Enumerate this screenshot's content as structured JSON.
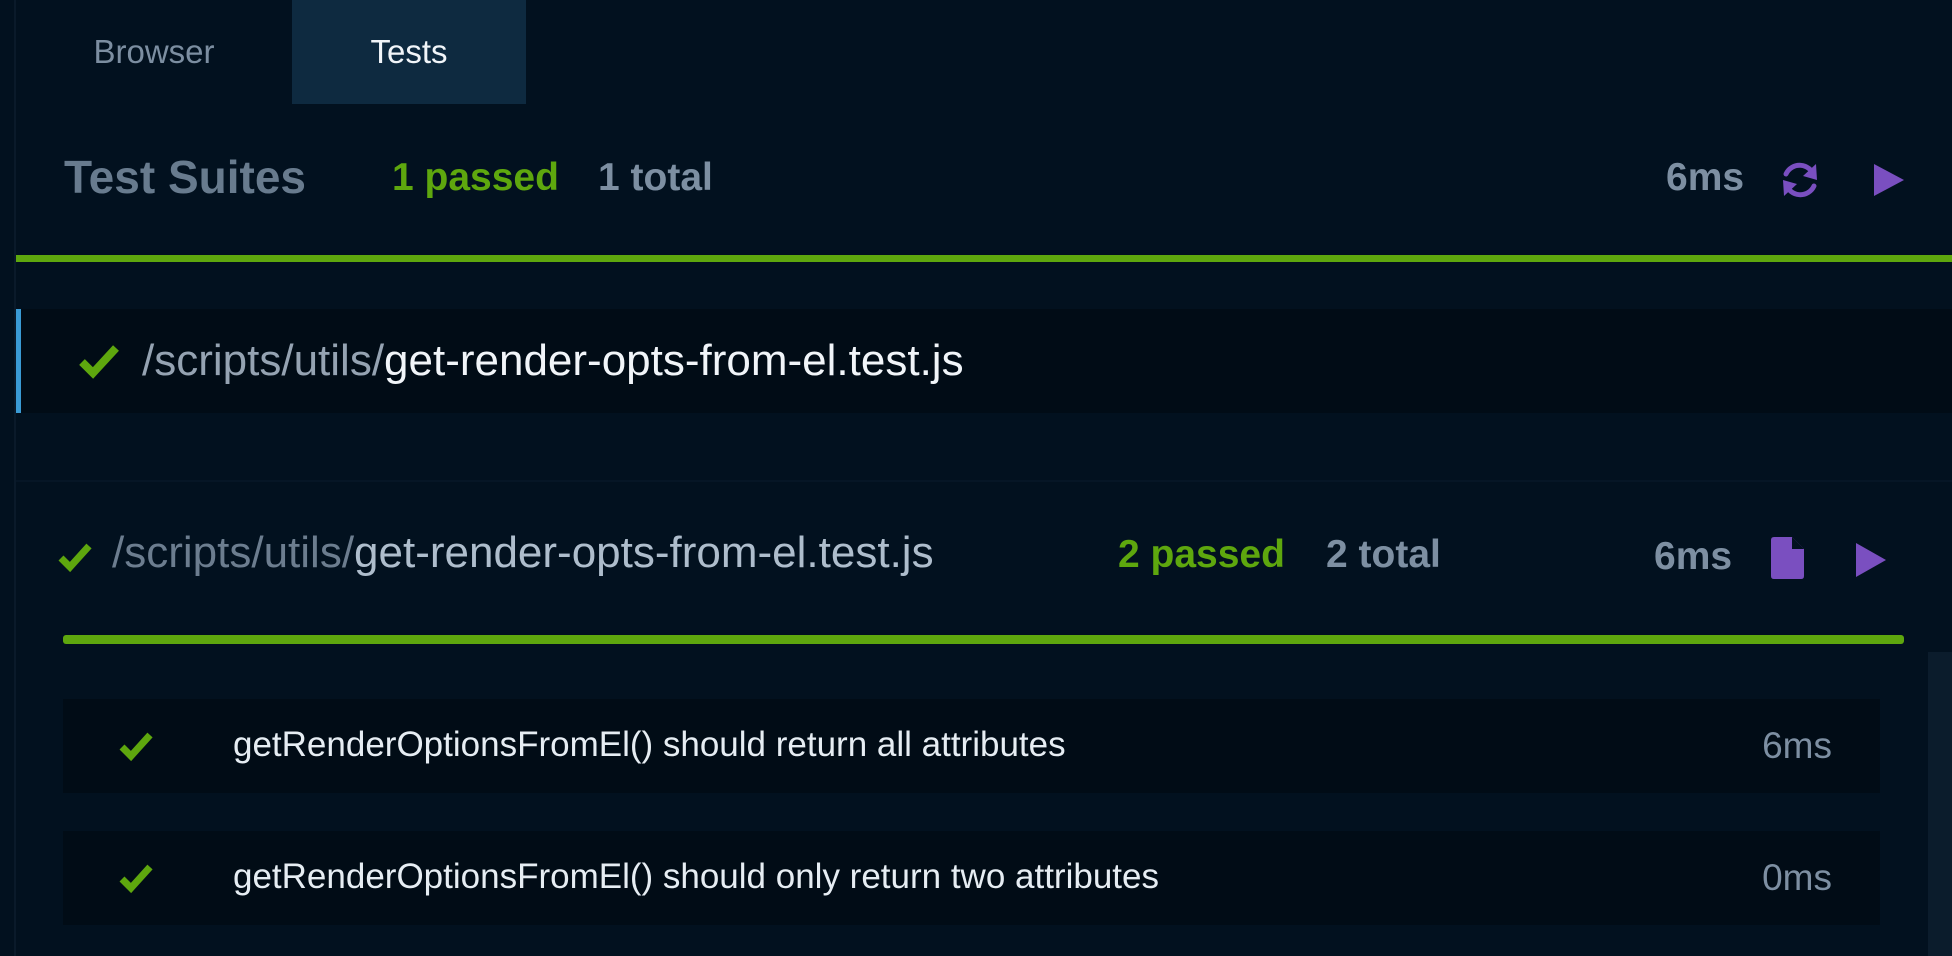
{
  "tabs": {
    "browser_label": "Browser",
    "tests_label": "Tests",
    "active": "Tests"
  },
  "suites_summary": {
    "title": "Test Suites",
    "passed": "1 passed",
    "total": "1 total",
    "duration": "6ms",
    "progress_fraction": 1.0,
    "icons": [
      "refresh-icon",
      "play-icon"
    ]
  },
  "selected_file": {
    "status_icon": "check-icon",
    "path_dir": "/scripts/utils/",
    "file_name": "get-render-opts-from-el.test.js"
  },
  "suite": {
    "status_icon": "check-icon",
    "path_dir": "/scripts/utils/",
    "file_name": "get-render-opts-from-el.test.js",
    "passed": "2 passed",
    "total": "2 total",
    "duration": "6ms",
    "progress_fraction": 1.0,
    "icons": [
      "file-icon",
      "play-icon"
    ],
    "tests": [
      {
        "name": "getRenderOptionsFromEl() should return all attributes",
        "duration": "6ms",
        "status": "passed"
      },
      {
        "name": "getRenderOptionsFromEl() should only return two attributes",
        "duration": "0ms",
        "status": "passed"
      }
    ]
  },
  "colors": {
    "background": "#02111f",
    "pass_green": "#5ea70e",
    "accent_purple": "#7a4fc0",
    "active_tab": "#0e2a40",
    "selection_marker": "#3a9bd5"
  }
}
